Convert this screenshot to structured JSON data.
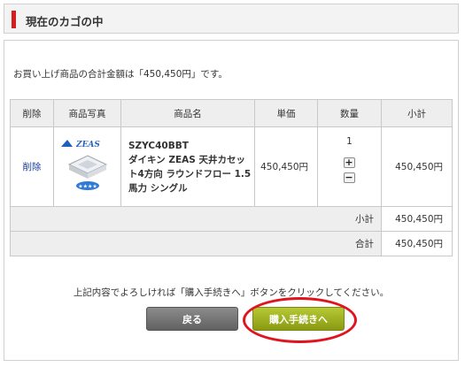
{
  "header": {
    "title": "現在のカゴの中"
  },
  "total_message": "お買い上げ商品の合計金額は「450,450円」です。",
  "table": {
    "columns": [
      "削除",
      "商品写真",
      "商品名",
      "単価",
      "数量",
      "小計"
    ],
    "item": {
      "delete_label": "削除",
      "product_code": "SZYC40BBT",
      "product_desc": "ダイキン ZEAS 天井カセット4方向 ラウンドフロー 1.5馬力 シングル",
      "unit_price": "450,450円",
      "quantity": "1",
      "subtotal": "450,450円",
      "plus_label": "+",
      "minus_label": "−"
    },
    "subtotal_row": {
      "label": "小計",
      "value": "450,450円"
    },
    "total_row": {
      "label": "合計",
      "value": "450,450円"
    }
  },
  "confirm_message": "上記内容でよろしければ「購入手続きへ」ボタンをクリックしてください。",
  "buttons": {
    "back": "戻る",
    "checkout": "購入手続きへ"
  },
  "colors": {
    "accent": "#d21f1f",
    "checkout": "#9cb120",
    "highlight": "#e0141e"
  }
}
